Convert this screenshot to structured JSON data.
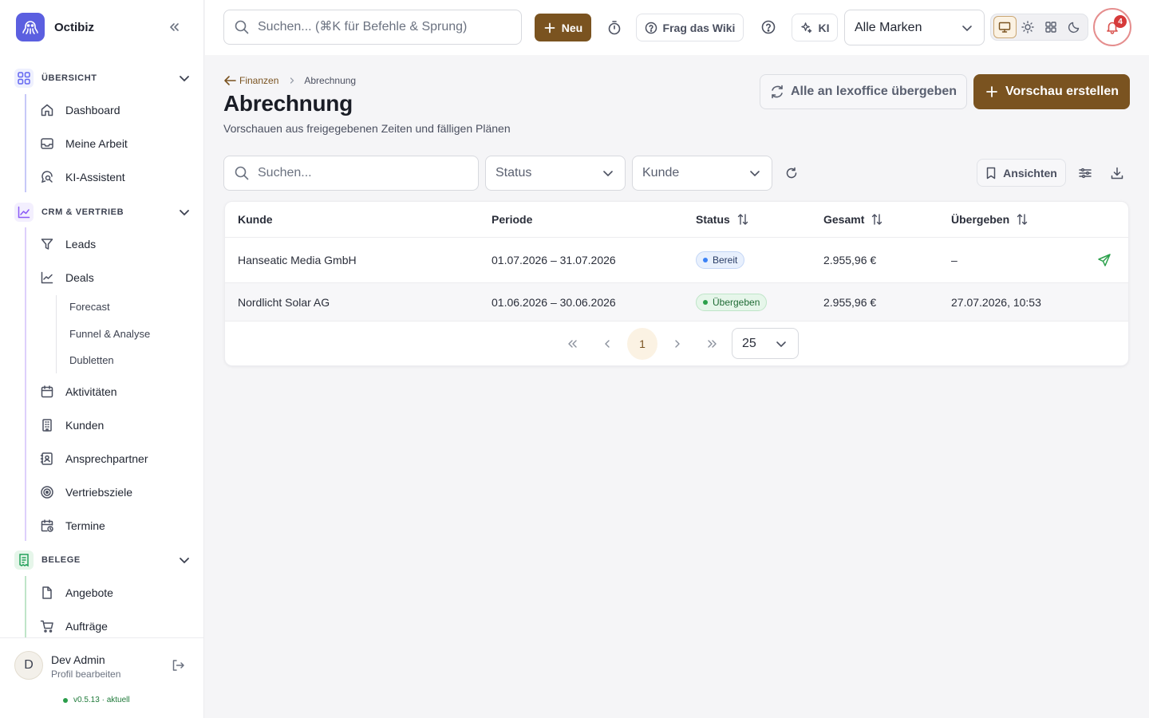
{
  "app": {
    "name": "Octibiz"
  },
  "sidebar": {
    "sections": [
      {
        "label": "ÜBERSICHT",
        "icon": "grid-icon",
        "color": "#6366f1"
      },
      {
        "label": "CRM & VERTRIEB",
        "icon": "chart-line-icon",
        "color": "#8b5cf6"
      },
      {
        "label": "BELEGE",
        "icon": "receipt-icon",
        "color": "#22a05a"
      }
    ],
    "overview_items": [
      {
        "label": "Dashboard",
        "icon": "home-icon"
      },
      {
        "label": "Meine Arbeit",
        "icon": "inbox-icon"
      },
      {
        "label": "KI-Assistent",
        "icon": "chat-search-icon"
      }
    ],
    "crm_items": [
      {
        "label": "Leads",
        "icon": "funnel-icon"
      },
      {
        "label": "Deals",
        "icon": "trend-icon"
      }
    ],
    "deal_sub_items": [
      {
        "label": "Forecast"
      },
      {
        "label": "Funnel & Analyse"
      },
      {
        "label": "Dubletten"
      }
    ],
    "crm_items_more": [
      {
        "label": "Aktivitäten",
        "icon": "calendar-icon"
      },
      {
        "label": "Kunden",
        "icon": "building-icon"
      },
      {
        "label": "Ansprechpartner",
        "icon": "contact-card-icon"
      },
      {
        "label": "Vertriebsziele",
        "icon": "target-icon"
      },
      {
        "label": "Termine",
        "icon": "calendar-clock-icon"
      }
    ],
    "belege_items": [
      {
        "label": "Angebote",
        "icon": "document-icon"
      },
      {
        "label": "Aufträge",
        "icon": "cart-icon"
      }
    ],
    "user": {
      "initial": "D",
      "name": "Dev Admin",
      "sub": "Profil bearbeiten"
    },
    "version": {
      "number": "v0.5.13",
      "status": "aktuell",
      "text": "v0.5.13 · aktuell"
    }
  },
  "topbar": {
    "search_placeholder": "Suchen... (⌘K für Befehle & Sprung)",
    "new_label": "Neu",
    "wiki_label": "Frag das Wiki",
    "ki_label": "KI",
    "brand_select": "Alle Marken",
    "notification_count": "4",
    "theme_options": [
      "monitor-icon",
      "sun-icon",
      "layout-icon",
      "moon-icon"
    ],
    "accent_color": "#7a5320"
  },
  "page": {
    "breadcrumb_parent": "Finanzen",
    "breadcrumb_current": "Abrechnung",
    "title": "Abrechnung",
    "subtitle": "Vorschauen aus freigegebenen Zeiten und fälligen Plänen",
    "lexoffice_button": "Alle an lexoffice übergeben",
    "preview_button": "Vorschau erstellen"
  },
  "filters": {
    "search_placeholder": "Suchen...",
    "status_label": "Status",
    "customer_label": "Kunde",
    "views_label": "Ansichten"
  },
  "table": {
    "columns": [
      "Kunde",
      "Periode",
      "Status",
      "Gesamt",
      "Übergeben"
    ],
    "rows": [
      {
        "kunde": "Hanseatic Media GmbH",
        "periode": "01.07.2026 – 31.07.2026",
        "status": "Bereit",
        "gesamt": "2.955,96 €",
        "uebergeben": "–"
      },
      {
        "kunde": "Nordlicht Solar AG",
        "periode": "01.06.2026 – 30.06.2026",
        "status": "Übergeben",
        "gesamt": "2.955,96 €",
        "uebergeben": "27.07.2026, 10:53"
      }
    ]
  },
  "pagination": {
    "current_page": "1",
    "page_size": "25"
  }
}
